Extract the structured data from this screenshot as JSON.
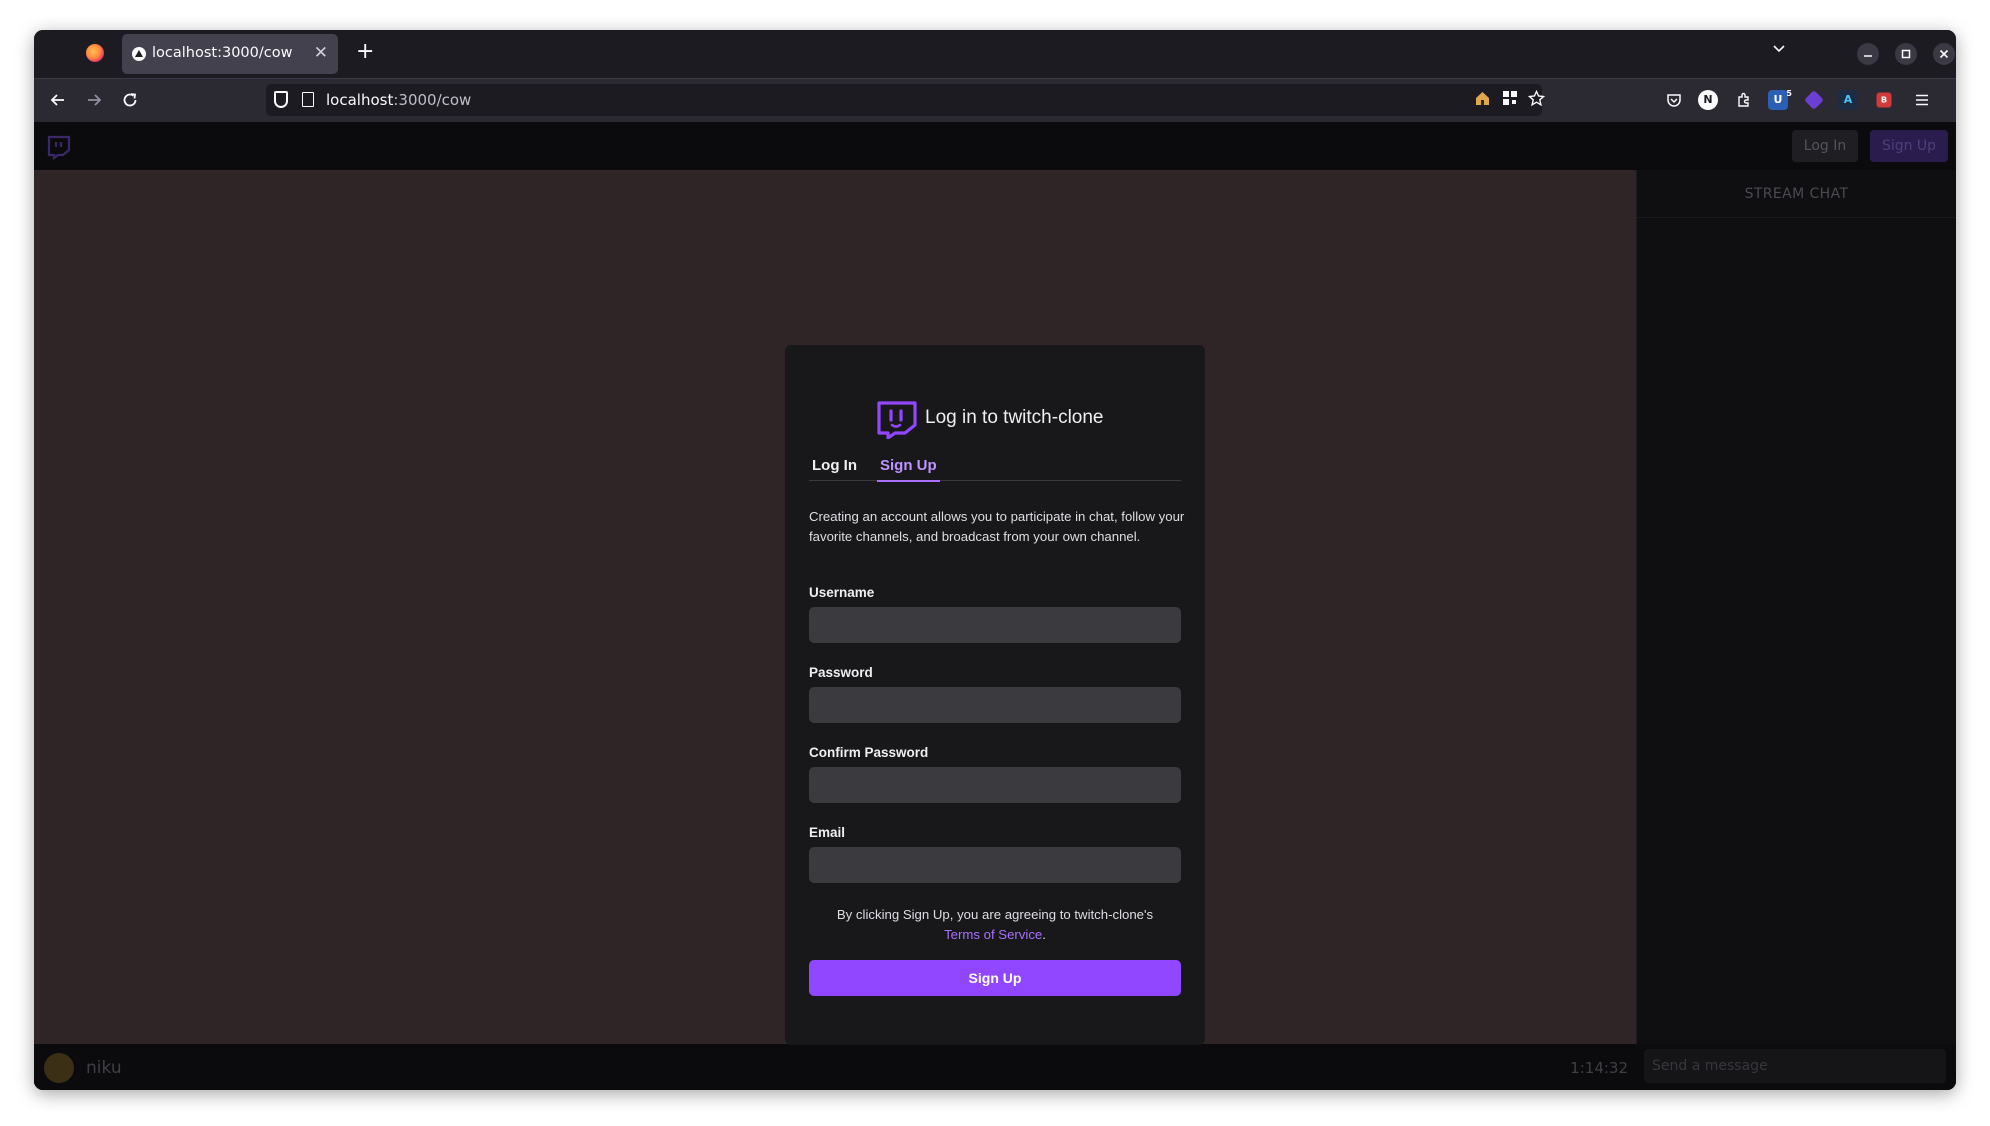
{
  "browser": {
    "tab": {
      "title": "localhost:3000/cow",
      "close_glyph": "✕"
    },
    "new_tab_glyph": "+",
    "url": {
      "host": "localhost",
      "path": ":3000/cow"
    },
    "icons": [
      "firefox-icon",
      "back-icon",
      "forward-icon",
      "reload-icon",
      "shield-icon",
      "page-icon",
      "home-icon",
      "qr-icon",
      "bookmark-star-icon",
      "pocket-icon",
      "notion-icon",
      "extensions-icon",
      "ublock-icon",
      "extension-purple-icon",
      "extension-am-icon",
      "extension-red-icon",
      "menu-icon"
    ],
    "extension_badges": {
      "n": "N",
      "am": "A",
      "red": "B",
      "ublock_count": "5"
    }
  },
  "app": {
    "header": {
      "login_label": "Log In",
      "signup_label": "Sign Up"
    },
    "chat": {
      "title": "STREAM CHAT",
      "input_placeholder": "Send a message"
    },
    "stream": {
      "streamer": "niku",
      "uptime": "1:14:32"
    },
    "modal": {
      "title": "Log in to twitch-clone",
      "tabs": {
        "login": "Log In",
        "signup": "Sign Up",
        "active": "Sign Up"
      },
      "description": "Creating an account allows you to participate in chat, follow your favorite channels, and broadcast from your own channel.",
      "fields": {
        "username_label": "Username",
        "username_value": "",
        "password_label": "Password",
        "password_value": "",
        "confirm_label": "Confirm Password",
        "confirm_value": "",
        "email_label": "Email",
        "email_value": ""
      },
      "terms_prefix": "By clicking Sign Up, you are agreeing to twitch-clone's",
      "terms_link": "Terms of Service",
      "terms_suffix": ".",
      "submit_label": "Sign Up"
    }
  },
  "colors": {
    "accent": "#9147ff",
    "accent_text": "#bf94ff",
    "modal_bg": "#18181b",
    "video_bg": "#2f2526",
    "input_bg": "#3a3a3f"
  }
}
